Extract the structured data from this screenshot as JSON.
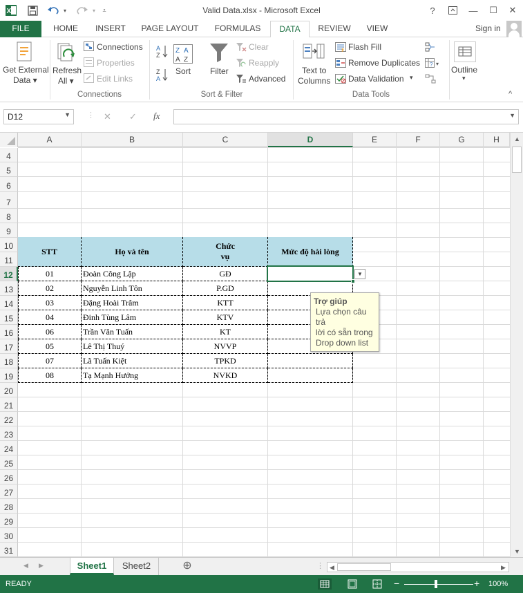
{
  "title": "Valid Data.xlsx - Microsoft Excel",
  "window_controls": {
    "help": "?",
    "restore_ribbon": "⧉",
    "minimize": "—",
    "maximize": "☐",
    "close": "✕"
  },
  "tabs": [
    "FILE",
    "HOME",
    "INSERT",
    "PAGE LAYOUT",
    "FORMULAS",
    "DATA",
    "REVIEW",
    "VIEW"
  ],
  "active_tab": "DATA",
  "signin": "Sign in",
  "ribbon": {
    "get_external_data": {
      "line1": "Get External",
      "line2": "Data ▾"
    },
    "refresh_all": {
      "line1": "Refresh",
      "line2": "All ▾"
    },
    "connections": "Connections",
    "properties": "Properties",
    "edit_links": "Edit Links",
    "group_connections": "Connections",
    "sort": "Sort",
    "filter": "Filter",
    "clear": "Clear",
    "reapply": "Reapply",
    "advanced": "Advanced",
    "group_sort_filter": "Sort & Filter",
    "text_to_columns": {
      "line1": "Text to",
      "line2": "Columns"
    },
    "flash_fill": "Flash Fill",
    "remove_duplicates": "Remove Duplicates",
    "data_validation": "Data Validation",
    "group_data_tools": "Data Tools",
    "outline": "Outline",
    "collapse": "^"
  },
  "formula_bar": {
    "name_box": "D12",
    "cancel": "✕",
    "enter": "✓",
    "fx": "fx",
    "value": ""
  },
  "columns": [
    "A",
    "B",
    "C",
    "D",
    "E",
    "F",
    "G",
    "H"
  ],
  "selected_column": "D",
  "rows": [
    "4",
    "5",
    "6",
    "7",
    "8",
    "9",
    "10",
    "11",
    "12",
    "13",
    "14",
    "15",
    "16",
    "17",
    "18",
    "19",
    "20",
    "21",
    "22",
    "23",
    "24",
    "25",
    "26",
    "27",
    "28",
    "29",
    "30",
    "31"
  ],
  "selected_row": "12",
  "table": {
    "headers": {
      "stt": "STT",
      "name": "Họ và tên",
      "title_line1": "Chức",
      "title_line2": "vụ",
      "satisfaction": "Mức độ hài lòng"
    },
    "rows": [
      {
        "stt": "01",
        "name": "Đoàn Công Lập",
        "title": "GĐ"
      },
      {
        "stt": "02",
        "name": "Nguyễn Linh Tôn",
        "title": "P.GD"
      },
      {
        "stt": "03",
        "name": "Đặng Hoài Trâm",
        "title": "KTT"
      },
      {
        "stt": "04",
        "name": "Đinh Tùng Lâm",
        "title": "KTV"
      },
      {
        "stt": "06",
        "name": "Trần Văn Tuấn",
        "title": "KT"
      },
      {
        "stt": "05",
        "name": "Lê Thị Thuý",
        "title": "NVVP"
      },
      {
        "stt": "07",
        "name": "Lã Tuấn Kiệt",
        "title": "TPKD"
      },
      {
        "stt": "08",
        "name": "Tạ Mạnh Hưởng",
        "title": "NVKD"
      }
    ]
  },
  "tooltip": {
    "title": "Trợ giúp",
    "line1": "Lựa chọn câu trả",
    "line2": "lời có sẵn trong",
    "line3": "Drop down list"
  },
  "sheets": [
    "Sheet1",
    "Sheet2"
  ],
  "active_sheet": "Sheet1",
  "add_sheet": "⊕",
  "status": {
    "text": "READY",
    "zoom": "100%"
  },
  "colors": {
    "accent": "#217346",
    "table_header": "#b7dde8",
    "tooltip_bg": "#ffffe1"
  }
}
